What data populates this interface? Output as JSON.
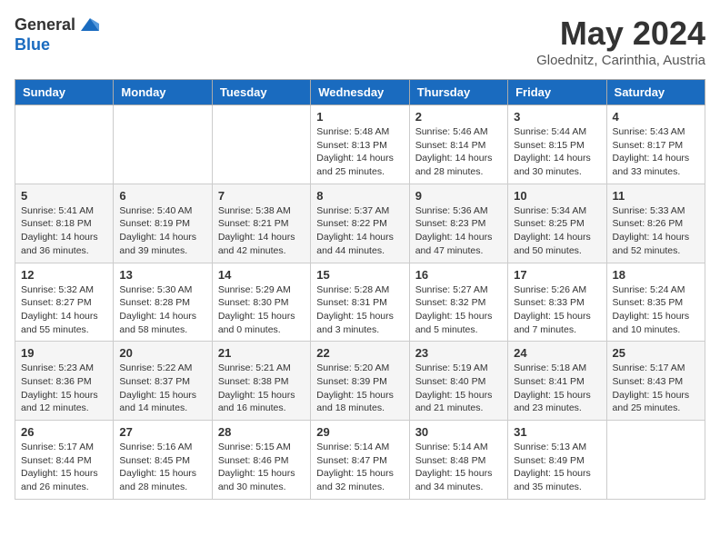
{
  "header": {
    "logo_general": "General",
    "logo_blue": "Blue",
    "month_title": "May 2024",
    "location": "Gloednitz, Carinthia, Austria"
  },
  "days_of_week": [
    "Sunday",
    "Monday",
    "Tuesday",
    "Wednesday",
    "Thursday",
    "Friday",
    "Saturday"
  ],
  "weeks": [
    [
      {
        "day": "",
        "info": ""
      },
      {
        "day": "",
        "info": ""
      },
      {
        "day": "",
        "info": ""
      },
      {
        "day": "1",
        "info": "Sunrise: 5:48 AM\nSunset: 8:13 PM\nDaylight: 14 hours and 25 minutes."
      },
      {
        "day": "2",
        "info": "Sunrise: 5:46 AM\nSunset: 8:14 PM\nDaylight: 14 hours and 28 minutes."
      },
      {
        "day": "3",
        "info": "Sunrise: 5:44 AM\nSunset: 8:15 PM\nDaylight: 14 hours and 30 minutes."
      },
      {
        "day": "4",
        "info": "Sunrise: 5:43 AM\nSunset: 8:17 PM\nDaylight: 14 hours and 33 minutes."
      }
    ],
    [
      {
        "day": "5",
        "info": "Sunrise: 5:41 AM\nSunset: 8:18 PM\nDaylight: 14 hours and 36 minutes."
      },
      {
        "day": "6",
        "info": "Sunrise: 5:40 AM\nSunset: 8:19 PM\nDaylight: 14 hours and 39 minutes."
      },
      {
        "day": "7",
        "info": "Sunrise: 5:38 AM\nSunset: 8:21 PM\nDaylight: 14 hours and 42 minutes."
      },
      {
        "day": "8",
        "info": "Sunrise: 5:37 AM\nSunset: 8:22 PM\nDaylight: 14 hours and 44 minutes."
      },
      {
        "day": "9",
        "info": "Sunrise: 5:36 AM\nSunset: 8:23 PM\nDaylight: 14 hours and 47 minutes."
      },
      {
        "day": "10",
        "info": "Sunrise: 5:34 AM\nSunset: 8:25 PM\nDaylight: 14 hours and 50 minutes."
      },
      {
        "day": "11",
        "info": "Sunrise: 5:33 AM\nSunset: 8:26 PM\nDaylight: 14 hours and 52 minutes."
      }
    ],
    [
      {
        "day": "12",
        "info": "Sunrise: 5:32 AM\nSunset: 8:27 PM\nDaylight: 14 hours and 55 minutes."
      },
      {
        "day": "13",
        "info": "Sunrise: 5:30 AM\nSunset: 8:28 PM\nDaylight: 14 hours and 58 minutes."
      },
      {
        "day": "14",
        "info": "Sunrise: 5:29 AM\nSunset: 8:30 PM\nDaylight: 15 hours and 0 minutes."
      },
      {
        "day": "15",
        "info": "Sunrise: 5:28 AM\nSunset: 8:31 PM\nDaylight: 15 hours and 3 minutes."
      },
      {
        "day": "16",
        "info": "Sunrise: 5:27 AM\nSunset: 8:32 PM\nDaylight: 15 hours and 5 minutes."
      },
      {
        "day": "17",
        "info": "Sunrise: 5:26 AM\nSunset: 8:33 PM\nDaylight: 15 hours and 7 minutes."
      },
      {
        "day": "18",
        "info": "Sunrise: 5:24 AM\nSunset: 8:35 PM\nDaylight: 15 hours and 10 minutes."
      }
    ],
    [
      {
        "day": "19",
        "info": "Sunrise: 5:23 AM\nSunset: 8:36 PM\nDaylight: 15 hours and 12 minutes."
      },
      {
        "day": "20",
        "info": "Sunrise: 5:22 AM\nSunset: 8:37 PM\nDaylight: 15 hours and 14 minutes."
      },
      {
        "day": "21",
        "info": "Sunrise: 5:21 AM\nSunset: 8:38 PM\nDaylight: 15 hours and 16 minutes."
      },
      {
        "day": "22",
        "info": "Sunrise: 5:20 AM\nSunset: 8:39 PM\nDaylight: 15 hours and 18 minutes."
      },
      {
        "day": "23",
        "info": "Sunrise: 5:19 AM\nSunset: 8:40 PM\nDaylight: 15 hours and 21 minutes."
      },
      {
        "day": "24",
        "info": "Sunrise: 5:18 AM\nSunset: 8:41 PM\nDaylight: 15 hours and 23 minutes."
      },
      {
        "day": "25",
        "info": "Sunrise: 5:17 AM\nSunset: 8:43 PM\nDaylight: 15 hours and 25 minutes."
      }
    ],
    [
      {
        "day": "26",
        "info": "Sunrise: 5:17 AM\nSunset: 8:44 PM\nDaylight: 15 hours and 26 minutes."
      },
      {
        "day": "27",
        "info": "Sunrise: 5:16 AM\nSunset: 8:45 PM\nDaylight: 15 hours and 28 minutes."
      },
      {
        "day": "28",
        "info": "Sunrise: 5:15 AM\nSunset: 8:46 PM\nDaylight: 15 hours and 30 minutes."
      },
      {
        "day": "29",
        "info": "Sunrise: 5:14 AM\nSunset: 8:47 PM\nDaylight: 15 hours and 32 minutes."
      },
      {
        "day": "30",
        "info": "Sunrise: 5:14 AM\nSunset: 8:48 PM\nDaylight: 15 hours and 34 minutes."
      },
      {
        "day": "31",
        "info": "Sunrise: 5:13 AM\nSunset: 8:49 PM\nDaylight: 15 hours and 35 minutes."
      },
      {
        "day": "",
        "info": ""
      }
    ]
  ]
}
